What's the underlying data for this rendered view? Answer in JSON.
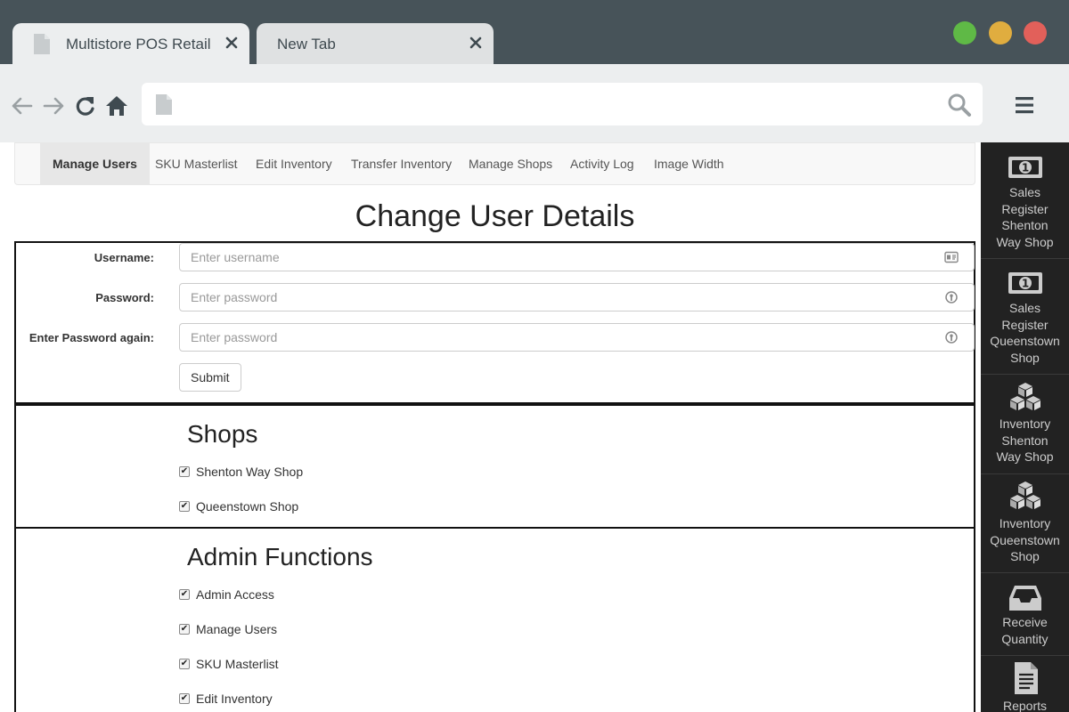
{
  "browser": {
    "tabs": [
      {
        "label": "Multistore POS Retail",
        "active": true
      },
      {
        "label": "New Tab",
        "active": false
      }
    ],
    "window_buttons": {
      "minimize_color": "#5fb946",
      "maximize_color": "#e0ad3f",
      "close_color": "#e2605a"
    },
    "address": ""
  },
  "navbar": {
    "items": [
      {
        "label": "Manage Users",
        "active": true
      },
      {
        "label": "SKU Masterlist"
      },
      {
        "label": "Edit Inventory"
      },
      {
        "label": "Transfer Inventory"
      },
      {
        "label": "Manage Shops"
      },
      {
        "label": "Activity Log"
      },
      {
        "label": "Image Width"
      }
    ]
  },
  "page": {
    "title": "Change User Details"
  },
  "form": {
    "username_label": "Username:",
    "username_placeholder": "Enter username",
    "password_label": "Password:",
    "password_placeholder": "Enter password",
    "password2_label": "Enter Password again:",
    "password2_placeholder": "Enter password",
    "submit_label": "Submit"
  },
  "shops": {
    "title": "Shops",
    "items": [
      {
        "label": "Shenton Way Shop",
        "checked": true
      },
      {
        "label": "Queenstown Shop",
        "checked": true
      }
    ]
  },
  "admin": {
    "title": "Admin Functions",
    "items": [
      {
        "label": "Admin Access",
        "checked": true
      },
      {
        "label": "Manage Users",
        "checked": true
      },
      {
        "label": "SKU Masterlist",
        "checked": true
      },
      {
        "label": "Edit Inventory",
        "checked": true
      }
    ]
  },
  "sidebar": {
    "items": [
      {
        "label_lines": [
          "Sales",
          "Register",
          "Shenton",
          "Way Shop"
        ],
        "icon": "money-icon"
      },
      {
        "label_lines": [
          "Sales",
          "Register",
          "Queenstown",
          "Shop"
        ],
        "icon": "money-icon"
      },
      {
        "label_lines": [
          "Inventory",
          "Shenton",
          "Way Shop"
        ],
        "icon": "boxes-icon"
      },
      {
        "label_lines": [
          "Inventory",
          "Queenstown",
          "Shop"
        ],
        "icon": "boxes-icon"
      },
      {
        "label_lines": [
          "Receive",
          "Quantity"
        ],
        "icon": "inbox-icon"
      },
      {
        "label_lines": [
          "Reports"
        ],
        "icon": "report-icon"
      }
    ]
  }
}
